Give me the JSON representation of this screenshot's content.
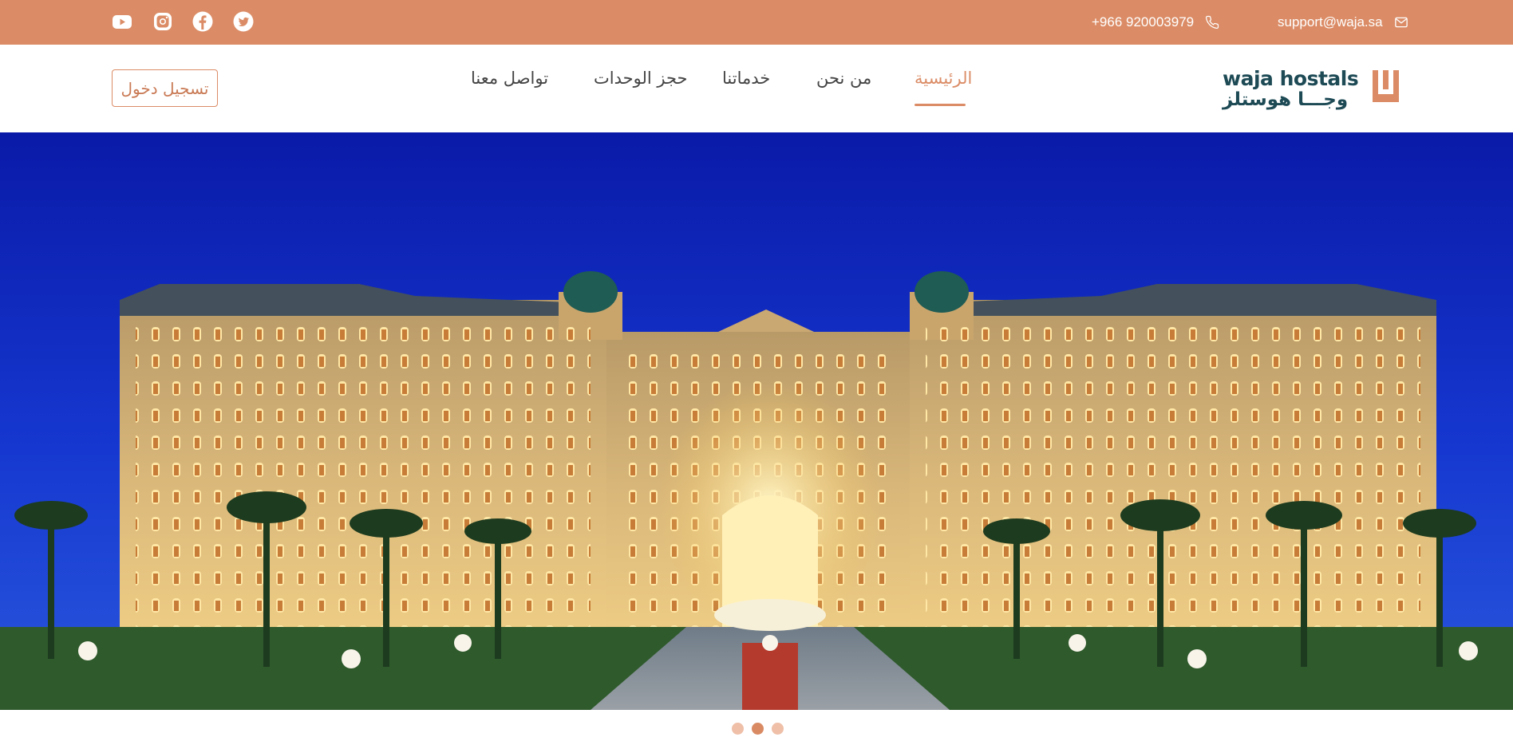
{
  "topbar": {
    "email": "support@waja.sa",
    "phone": "+966 920003979",
    "social_icons": [
      "youtube-icon",
      "instagram-icon",
      "facebook-icon",
      "twitter-icon"
    ]
  },
  "brand": {
    "logo_text_latin": "waja hostals",
    "logo_text_arabic": "وجـــا هوستلز",
    "accent_color": "#db8c66",
    "dark_color": "#1d4a55"
  },
  "nav": {
    "items": [
      {
        "label": "الرئيسية",
        "active": true
      },
      {
        "label": "من نحن",
        "active": false
      },
      {
        "label": "خدماتنا",
        "active": false
      },
      {
        "label": "حجز الوحدات",
        "active": false
      },
      {
        "label": "تواصل معنا",
        "active": false
      }
    ],
    "login_label": "تسجيل دخول"
  },
  "hero": {
    "image": "illuminated-palace-hotel-at-night"
  },
  "carousel": {
    "slide_count": 3,
    "active_index": 1
  }
}
